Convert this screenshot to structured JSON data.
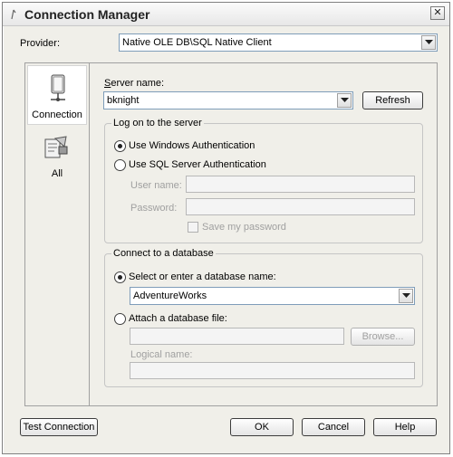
{
  "window": {
    "title": "Connection Manager",
    "close_glyph": "✕"
  },
  "provider": {
    "label": "Provider:",
    "value": "Native OLE DB\\SQL Native Client"
  },
  "nav": {
    "items": [
      {
        "label": "Connection",
        "icon": "server-icon",
        "selected": true
      },
      {
        "label": "All",
        "icon": "properties-icon",
        "selected": false
      }
    ]
  },
  "server": {
    "label": "Server name:",
    "value": "bknight",
    "refresh_label": "Refresh"
  },
  "logon": {
    "group_title": "Log on to the server",
    "windows_auth_label": "Use Windows Authentication",
    "sql_auth_label": "Use SQL Server Authentication",
    "selected": "windows",
    "username_label": "User name:",
    "password_label": "Password:",
    "save_password_label": "Save my password"
  },
  "database": {
    "group_title": "Connect to a database",
    "select_label": "Select or enter a database name:",
    "db_value": "AdventureWorks",
    "attach_label": "Attach a database file:",
    "browse_label": "Browse...",
    "logical_name_label": "Logical name:",
    "selected": "select"
  },
  "footer": {
    "test_connection": "Test Connection",
    "ok": "OK",
    "cancel": "Cancel",
    "help": "Help"
  }
}
